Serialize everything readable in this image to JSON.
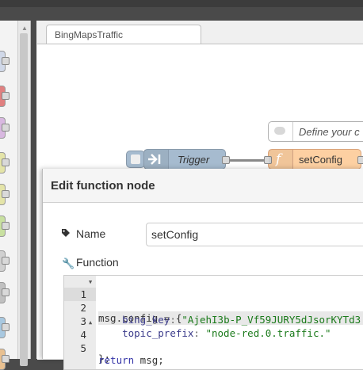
{
  "palette": {
    "node_colors": [
      "#d0d8e8",
      "#e08080",
      "#d8b8e0",
      "#e4e4a8",
      "#e4e4a8",
      "#c8e0a0",
      "#d0d0d0",
      "#c0c0c0",
      "#a8c8e0",
      "#e8c090"
    ]
  },
  "workspace": {
    "tab_label": "BingMapsTraffic",
    "nodes": {
      "comment": {
        "label": "Define your c"
      },
      "trigger": {
        "label": "Trigger"
      },
      "function": {
        "label": "setConfig"
      }
    }
  },
  "dialog": {
    "title": "Edit function node",
    "name_label": "Name",
    "name_value": "setConfig",
    "function_label": "Function",
    "code": {
      "line_numbers": [
        "1",
        "2",
        "3",
        "4",
        "5"
      ],
      "line1": "msg.config = {",
      "line2_key": "bing_key",
      "line2_value": "\"AjehI3b-P_Vf59JURY5dJsorKYTd3",
      "line3_key": "topic_prefix",
      "line3_value": "\"node-red.0.traffic.\"",
      "line4": "};",
      "line5_kw": "return",
      "line5_rest": " msg;"
    }
  },
  "colors": {
    "trigger_node": "#a6bbcf",
    "function_node": "#fdd0a2",
    "string": "#1a7a1a",
    "keyword": "#3434a8"
  }
}
